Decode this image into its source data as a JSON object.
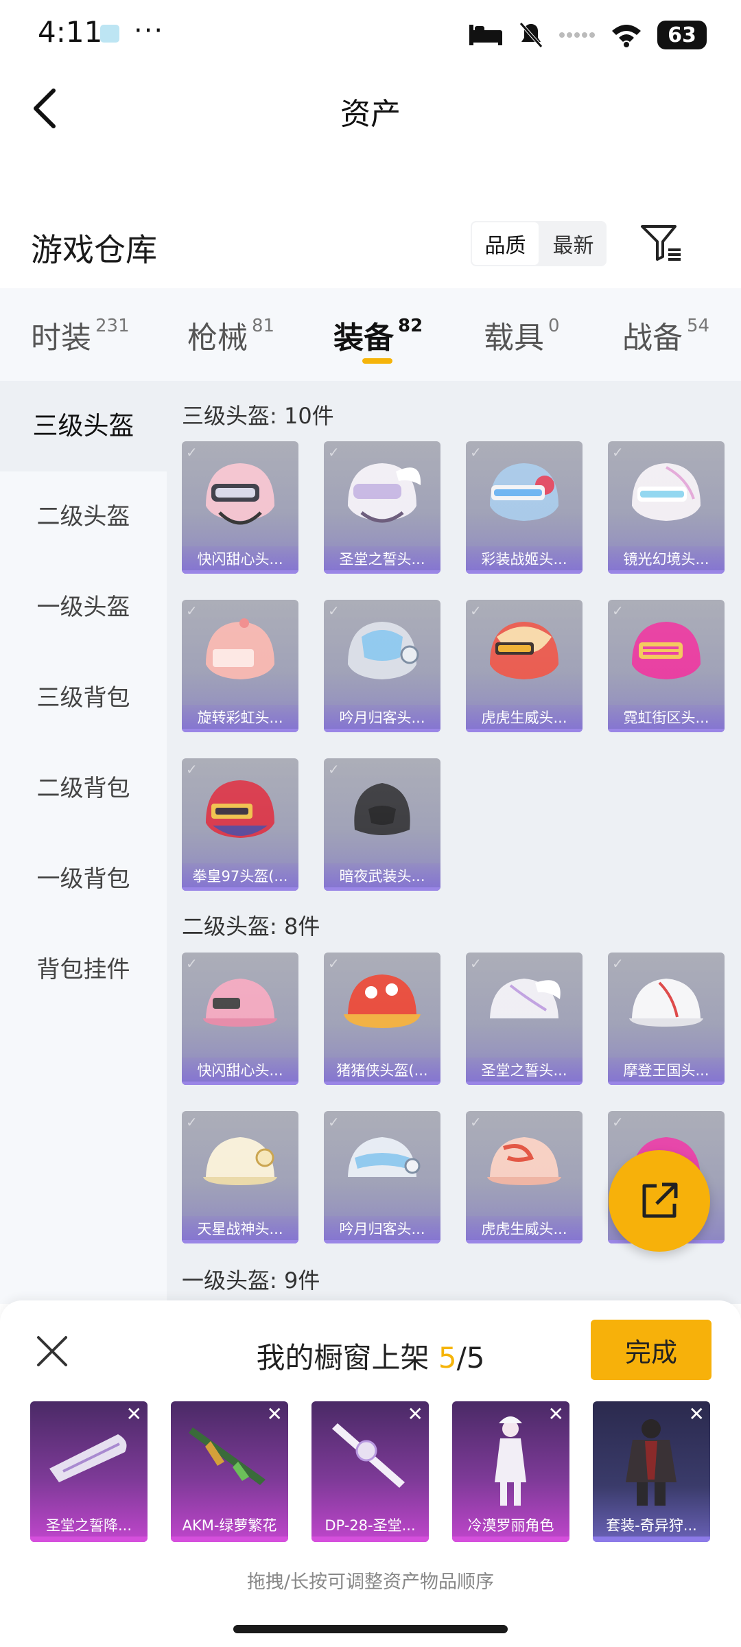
{
  "status_bar": {
    "time": "4:11",
    "dots": "···",
    "battery": "63"
  },
  "header": {
    "title": "资产"
  },
  "warehouse": {
    "title": "游戏仓库",
    "sort_options": [
      "品质",
      "最新"
    ]
  },
  "tabs": [
    {
      "label": "时装",
      "count": "231"
    },
    {
      "label": "枪械",
      "count": "81"
    },
    {
      "label": "装备",
      "count": "82"
    },
    {
      "label": "载具",
      "count": "0"
    },
    {
      "label": "战备",
      "count": "54"
    }
  ],
  "sidebar": {
    "items": [
      "三级头盔",
      "二级头盔",
      "一级头盔",
      "三级背包",
      "二级背包",
      "一级背包",
      "背包挂件"
    ]
  },
  "sections": [
    {
      "title": "三级头盔: 10件",
      "items": [
        "快闪甜心头...",
        "圣堂之誓头...",
        "彩装战姬头...",
        "镜光幻境头...",
        "旋转彩虹头...",
        "吟月归客头...",
        "虎虎生威头...",
        "霓虹街区头...",
        "拳皇97头盔(...",
        "暗夜武装头..."
      ]
    },
    {
      "title": "二级头盔: 8件",
      "items": [
        "快闪甜心头...",
        "猪猪侠头盔(...",
        "圣堂之誓头...",
        "摩登王国头...",
        "天星战神头...",
        "吟月归客头...",
        "虎虎生威头..."
      ]
    },
    {
      "title": "一级头盔: 9件",
      "items": []
    }
  ],
  "sheet": {
    "title_prefix": "我的橱窗上架 ",
    "count_current": "5",
    "count_total": "/5",
    "done_label": "完成",
    "items": [
      "圣堂之誓降...",
      "AKM-绿萝繁花",
      "DP-28-圣堂...",
      "冷漠罗丽角色",
      "套装-奇异狩..."
    ],
    "remove_symbol": "✕",
    "hint": "拖拽/长按可调整资产物品顺序"
  },
  "colors": {
    "accent": "#f7b10a",
    "card_purple": "#8d86c4",
    "shelf_magenta": "#c046cc"
  }
}
